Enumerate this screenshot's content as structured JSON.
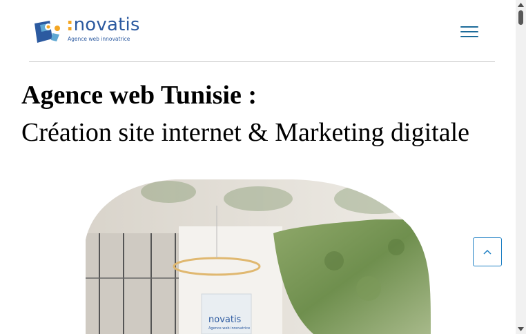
{
  "header": {
    "logo": {
      "word": "novatis",
      "tagline": "Agence web innovatrice"
    },
    "menu_icon": "hamburger-menu-icon"
  },
  "main": {
    "title_bold": "Agence web Tunisie :",
    "title_regular": "Création site internet & Marketing digitale"
  },
  "hero": {
    "sign_word": "novatis",
    "sign_tagline": "Agence web innovatrice"
  },
  "scroll_top": {
    "icon": "chevron-up-icon"
  },
  "colors": {
    "brand_blue": "#2c5aa0",
    "brand_orange": "#f4a623",
    "menu_blue": "#1d6b9a",
    "scroll_button_border": "#1d7fc4"
  }
}
